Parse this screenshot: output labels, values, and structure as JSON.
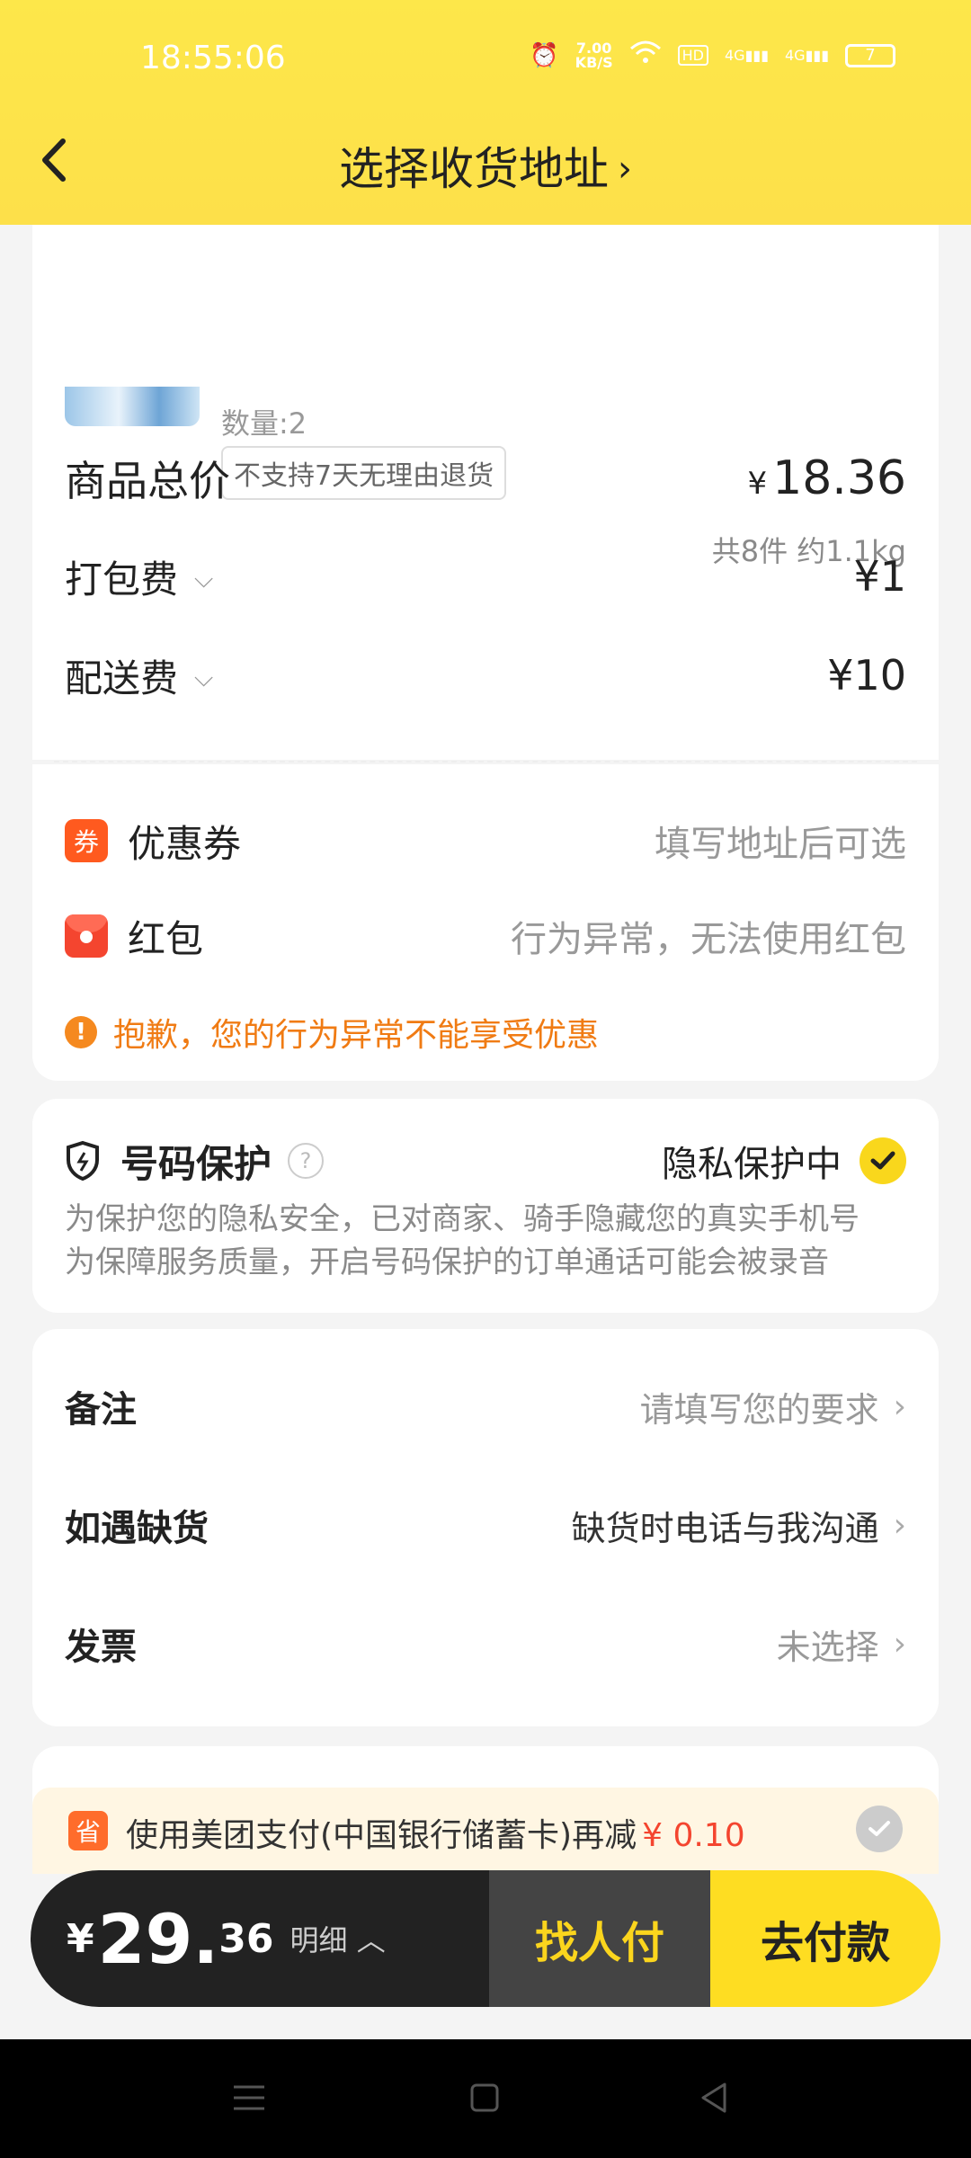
{
  "status_bar": {
    "time": "18:55:06",
    "net_speed": "7.00",
    "net_unit": "KB/S",
    "net1": "4G",
    "net2": "4G",
    "battery": "7"
  },
  "nav": {
    "title": "选择收货地址",
    "title_chevron": "›"
  },
  "order": {
    "quantity": "数量:2",
    "return_tag": "不支持7天无理由退货",
    "summary": "共8件 约1.1kg",
    "total_label": "商品总价",
    "total_currency": "¥",
    "total_value": "18.36",
    "packing_label": "打包费",
    "packing_value": "¥1",
    "delivery_label": "配送费",
    "delivery_value": "¥10"
  },
  "discounts": {
    "coupon_icon": "券",
    "coupon_label": "优惠券",
    "coupon_value": "填写地址后可选",
    "redpack_label": "红包",
    "redpack_value": "行为异常，无法使用红包",
    "warning": "抱歉，您的行为异常不能享受优惠",
    "warning_icon": "!"
  },
  "privacy": {
    "title": "号码保护",
    "help_icon": "?",
    "status": "隐私保护中",
    "desc_line1": "为保护您的隐私安全，已对商家、骑手隐藏您的真实手机号",
    "desc_line2": "为保障服务质量，开启号码保护的订单通话可能会被录音"
  },
  "options": [
    {
      "label": "备注",
      "value": "请填写您的要求"
    },
    {
      "label": "如遇缺货",
      "value": "缺货时电话与我沟通"
    },
    {
      "label": "发票",
      "value": "未选择"
    }
  ],
  "promo": {
    "icon": "省",
    "text": "使用美团支付(中国银行储蓄卡)再减",
    "amount": "¥ 0.10"
  },
  "paybar": {
    "currency": "¥",
    "total_int": "29.",
    "total_dec": "36",
    "detail": "明细",
    "find_payer": "找人付",
    "pay": "去付款"
  },
  "colors": {
    "brand_yellow": "#fde04a",
    "warning_orange": "#f07b13",
    "red": "#f4452f"
  }
}
